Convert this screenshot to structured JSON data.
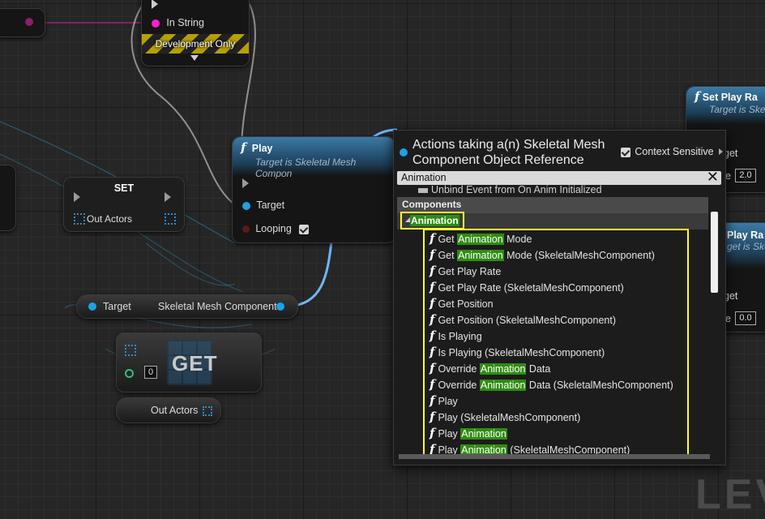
{
  "print_node": {
    "in_string_label": "In String",
    "dev_only_label": "Development Only"
  },
  "set_node": {
    "title": "SET",
    "out_actors_label": "Out Actors"
  },
  "play_node": {
    "title": "Play",
    "subtitle": "Target is Skeletal Mesh Compon",
    "target_label": "Target",
    "looping_label": "Looping"
  },
  "var_node": {
    "target_label": "Target",
    "component_label": "Skeletal Mesh Component"
  },
  "get_node": {
    "title": "GET",
    "index_value": "0"
  },
  "out_actors_node": {
    "label": "Out Actors"
  },
  "set_play_rate_node": {
    "title": "Set Play Ra",
    "subtitle": "Target is Ske",
    "target_label": "get",
    "rate_label": "e",
    "rate_value": "2.0"
  },
  "play_node_right": {
    "title": "Play Ra",
    "subtitle": "get is Ske",
    "target_label": "get",
    "rate_label": "e",
    "rate_value": "0.0"
  },
  "watermark": "LEV",
  "action_menu": {
    "title_line1": "Actions taking a(n) Skeletal Mesh",
    "title_line2": "Component Object Reference",
    "context_sensitive_label": "Context Sensitive",
    "search_value": "Animation",
    "partial_row": "Unbind Event from On Anim Initialized",
    "category": "Components",
    "subcategory": "Animation",
    "items": [
      {
        "pre": "Get ",
        "hl": "Animation",
        "post": " Mode"
      },
      {
        "pre": "Get ",
        "hl": "Animation",
        "post": " Mode (SkeletalMeshComponent)"
      },
      {
        "pre": "Get Play Rate",
        "hl": "",
        "post": ""
      },
      {
        "pre": "Get Play Rate (SkeletalMeshComponent)",
        "hl": "",
        "post": ""
      },
      {
        "pre": "Get Position",
        "hl": "",
        "post": ""
      },
      {
        "pre": "Get Position (SkeletalMeshComponent)",
        "hl": "",
        "post": ""
      },
      {
        "pre": "Is Playing",
        "hl": "",
        "post": ""
      },
      {
        "pre": "Is Playing (SkeletalMeshComponent)",
        "hl": "",
        "post": ""
      },
      {
        "pre": "Override ",
        "hl": "Animation",
        "post": " Data"
      },
      {
        "pre": "Override ",
        "hl": "Animation",
        "post": " Data (SkeletalMeshComponent)"
      },
      {
        "pre": "Play",
        "hl": "",
        "post": ""
      },
      {
        "pre": "Play (SkeletalMeshComponent)",
        "hl": "",
        "post": ""
      },
      {
        "pre": "Play ",
        "hl": "Animation",
        "post": ""
      },
      {
        "pre": "Play ",
        "hl": "Animation",
        "post": " (SkeletalMeshComponent)"
      }
    ],
    "colors": {
      "highlight": "#2f8c12",
      "annotation": "#ffff33",
      "search_bg": "#d9d9d9"
    }
  }
}
